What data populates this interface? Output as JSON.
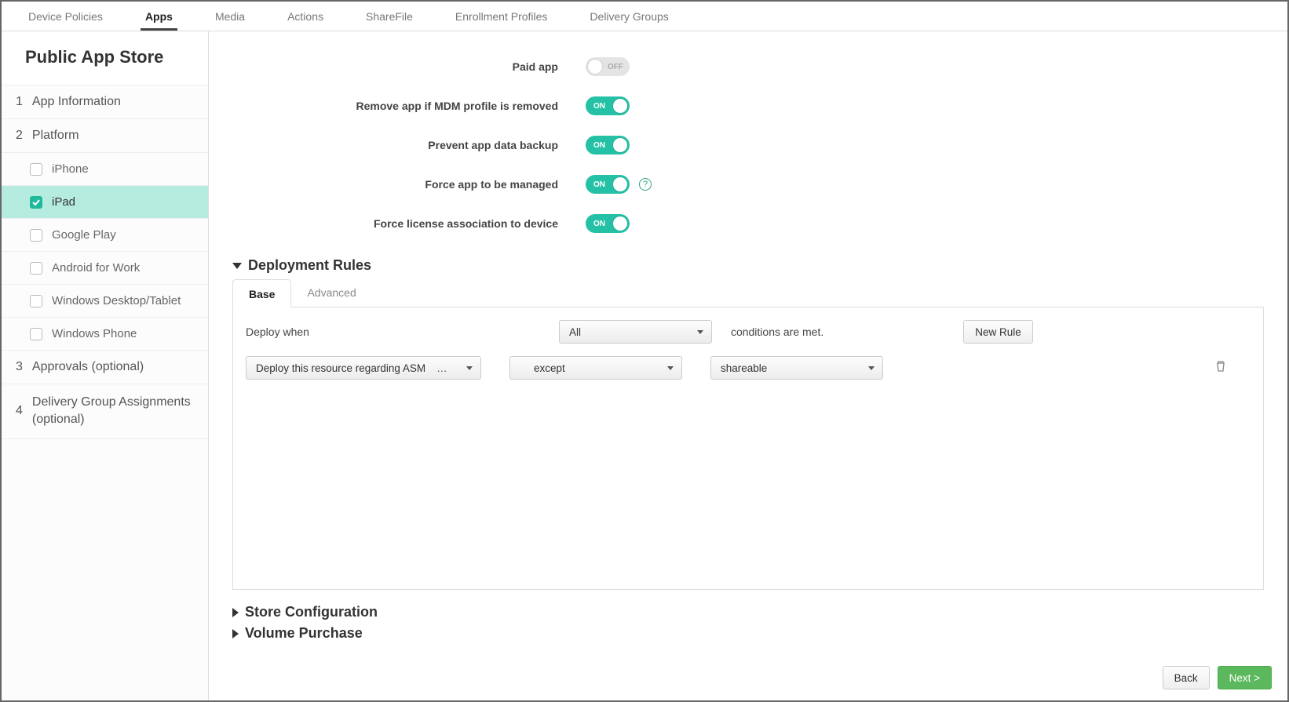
{
  "topTabs": {
    "devicePolicies": "Device Policies",
    "apps": "Apps",
    "media": "Media",
    "actions": "Actions",
    "sharefile": "ShareFile",
    "enrollmentProfiles": "Enrollment Profiles",
    "deliveryGroups": "Delivery Groups"
  },
  "sidebar": {
    "title": "Public App Store",
    "step1": "App Information",
    "step2": "Platform",
    "platforms": {
      "iphone": "iPhone",
      "ipad": "iPad",
      "googlePlay": "Google Play",
      "androidWork": "Android for Work",
      "winDesktop": "Windows Desktop/Tablet",
      "winPhone": "Windows Phone"
    },
    "step3": "Approvals (optional)",
    "step4": "Delivery Group Assignments (optional)"
  },
  "settings": {
    "paidApp": {
      "label": "Paid app",
      "state": "OFF"
    },
    "removeMdm": {
      "label": "Remove app if MDM profile is removed",
      "state": "ON"
    },
    "preventBackup": {
      "label": "Prevent app data backup",
      "state": "ON"
    },
    "forceManaged": {
      "label": "Force app to be managed",
      "state": "ON"
    },
    "forceLicense": {
      "label": "Force license association to device",
      "state": "ON"
    }
  },
  "sections": {
    "deploymentRules": "Deployment Rules",
    "storeConfig": "Store Configuration",
    "volumePurchase": "Volume Purchase"
  },
  "ruleTabs": {
    "base": "Base",
    "advanced": "Advanced"
  },
  "rulesPanel": {
    "deployWhen": "Deploy when",
    "allSelect": "All",
    "conditionsMet": "conditions are met.",
    "newRule": "New Rule",
    "rule1": {
      "resource": "Deploy this resource regarding ASM",
      "ellipsis": "…",
      "op": "except",
      "value": "shareable"
    }
  },
  "footer": {
    "back": "Back",
    "next": "Next >"
  },
  "steps": {
    "n1": "1",
    "n2": "2",
    "n3": "3",
    "n4": "4"
  }
}
